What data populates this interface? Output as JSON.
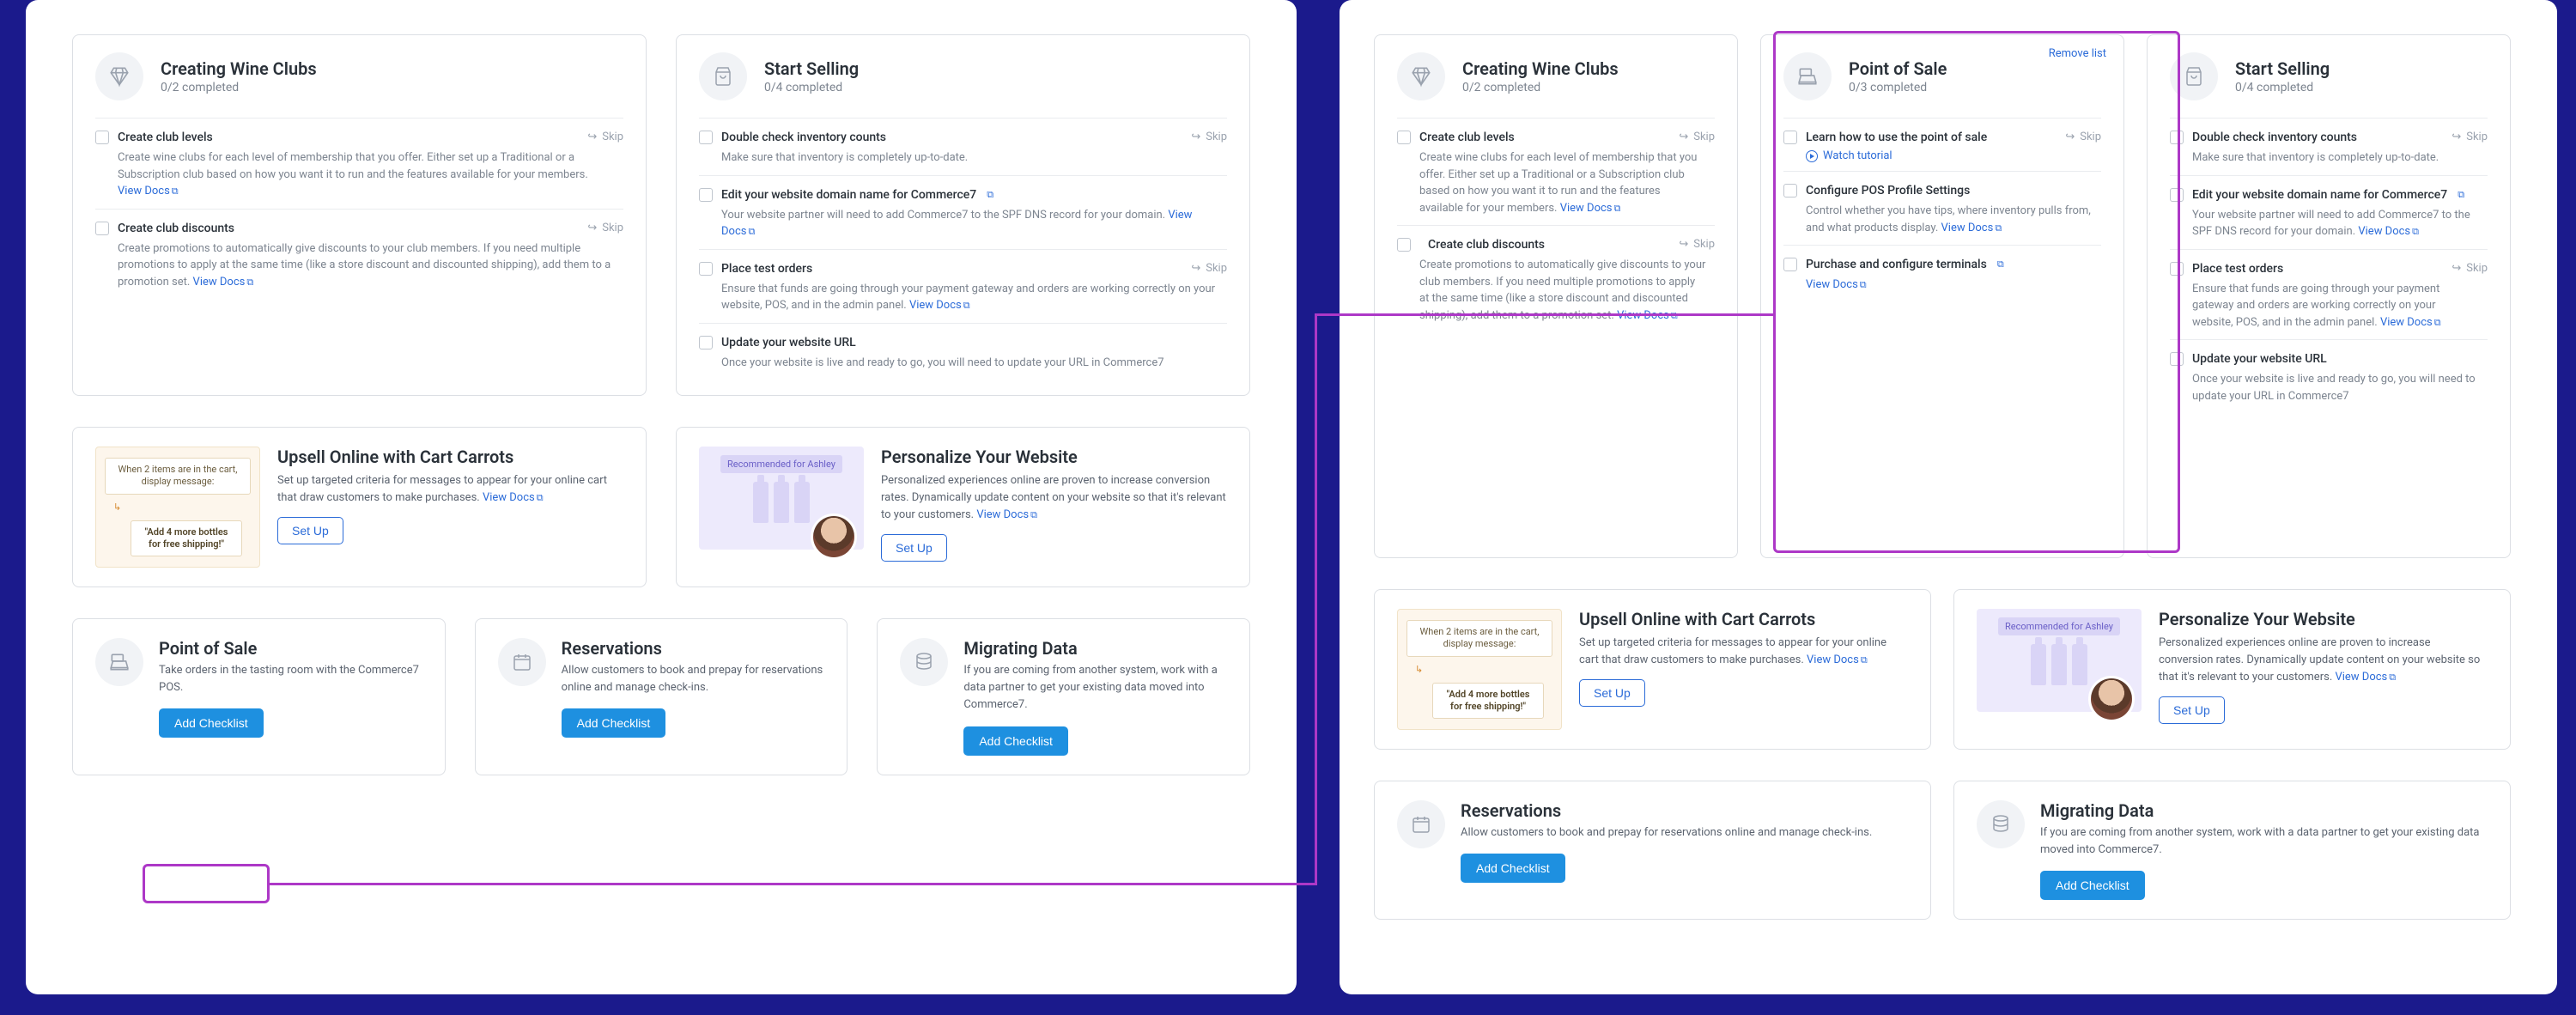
{
  "common": {
    "view_docs": "View Docs",
    "skip": "Skip",
    "set_up": "Set Up",
    "add_checklist": "Add Checklist",
    "remove_list": "Remove list",
    "watch_tutorial": "Watch tutorial"
  },
  "wine": {
    "title": "Creating Wine Clubs",
    "sub": "0/2 completed",
    "t1_title": "Create club levels",
    "t1_desc_a": "Create wine clubs for each level of membership that you offer. Either set up a Traditional or a Subscription club based on how you want it to run and the features available for your members. ",
    "t2_title": "Create club discounts",
    "t2_desc_a": "Create promotions to automatically give discounts to your club members. If you need multiple promotions to apply at the same time (like a store discount and discounted shipping), add them to a promotion set. "
  },
  "sell": {
    "title": "Start Selling",
    "sub": "0/4 completed",
    "t1_title": "Double check inventory counts",
    "t1_desc": "Make sure that inventory is completely up-to-date.",
    "t2_title": "Edit your website domain name for Commerce7",
    "t2_desc": "Your website partner will need to add Commerce7 to the SPF DNS record for your domain. ",
    "t3_title": "Place test orders",
    "t3_desc": "Ensure that funds are going through your payment gateway and orders are working correctly on your website, POS, and in the admin panel. ",
    "t4_title": "Update your website URL",
    "t4_desc": "Once your website is live and ready to go, you will need to update your URL in Commerce7"
  },
  "pos_card": {
    "title": "Point of Sale",
    "sub": "0/3 completed",
    "t1_title": "Learn how to use the point of sale",
    "t2_title": "Configure POS Profile Settings",
    "t2_desc": "Control whether you have tips, where inventory pulls from, and what products display. ",
    "t3_title": "Purchase and configure terminals"
  },
  "promo": {
    "carrot_title": "Upsell Online with Cart Carrots",
    "carrot_desc": "Set up targeted criteria for messages to appear for your online cart that draw customers to make purchases. ",
    "carrot_msg1": "When 2 items are in the cart, display message:",
    "carrot_msg2": "\"Add 4 more bottles for free shipping!\"",
    "pers_title": "Personalize Your Website",
    "pers_desc": "Personalized experiences online are proven to increase conversion rates. Dynamically update content on your website so that it's relevant to your customers. ",
    "pers_pill": "Recommended for Ashley"
  },
  "add": {
    "pos_title": "Point of Sale",
    "pos_desc": "Take orders in the tasting room with the Commerce7 POS.",
    "res_title": "Reservations",
    "res_desc_short": "Allow customers to book and prepay for reservations online and manage check-ins.",
    "mig_title": "Migrating Data",
    "mig_desc_short": "If you are coming from another system, work with a data partner to get your existing data moved into Commerce7.",
    "mig_desc_long": "If you are coming from another system, work with a data partner to get your existing data moved into Commerce7."
  }
}
